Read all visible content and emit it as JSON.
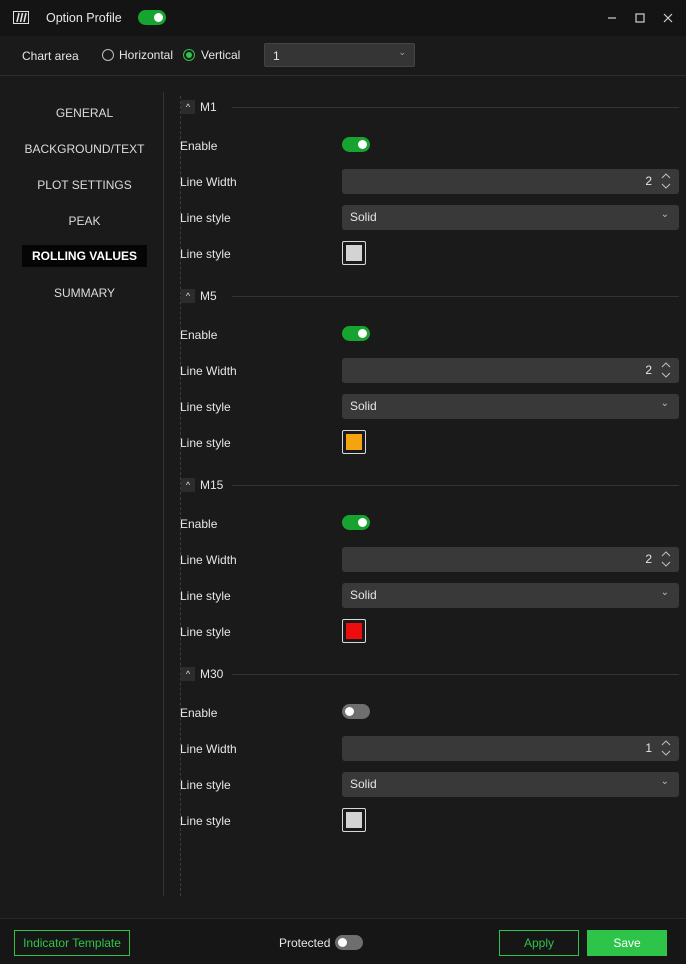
{
  "titlebar": {
    "title": "Option Profile",
    "profile_toggle": true,
    "minimize_icon": "minimize-icon",
    "maximize_icon": "maximize-icon",
    "close_icon": "close-icon"
  },
  "chart_area": {
    "label": "Chart area",
    "options": [
      {
        "label": "Horizontal",
        "checked": false
      },
      {
        "label": "Vertical",
        "checked": true
      }
    ],
    "select_value": "1"
  },
  "sidebar": {
    "items": [
      {
        "label": "GENERAL",
        "active": false
      },
      {
        "label": "BACKGROUND/TEXT",
        "active": false
      },
      {
        "label": "PLOT SETTINGS",
        "active": false
      },
      {
        "label": "PEAK",
        "active": false
      },
      {
        "label": "ROLLING VALUES",
        "active": true
      },
      {
        "label": "SUMMARY",
        "active": false
      }
    ]
  },
  "sections": [
    {
      "title": "M1",
      "enable_label": "Enable",
      "enabled": true,
      "width_label": "Line Width",
      "width_value": "2",
      "style_label": "Line style",
      "style_value": "Solid",
      "color_label": "Line style",
      "color": "#d3d3d3"
    },
    {
      "title": "M5",
      "enable_label": "Enable",
      "enabled": true,
      "width_label": "Line Width",
      "width_value": "2",
      "style_label": "Line style",
      "style_value": "Solid",
      "color_label": "Line style",
      "color": "#f5a30f"
    },
    {
      "title": "M15",
      "enable_label": "Enable",
      "enabled": true,
      "width_label": "Line Width",
      "width_value": "2",
      "style_label": "Line style",
      "style_value": "Solid",
      "color_label": "Line style",
      "color": "#ee0d0d"
    },
    {
      "title": "M30",
      "enable_label": "Enable",
      "enabled": false,
      "width_label": "Line Width",
      "width_value": "1",
      "style_label": "Line style",
      "style_value": "Solid",
      "color_label": "Line style",
      "color": "#d3d3d3"
    }
  ],
  "footer": {
    "template_label": "Indicator Template",
    "protected_label": "Protected",
    "protected": false,
    "apply_label": "Apply",
    "save_label": "Save"
  },
  "colors": {
    "accent": "#2ec44a",
    "toggle_on": "#17a32f",
    "toggle_off": "#6e6e6e",
    "background": "#1a1a1a",
    "field": "#393939"
  }
}
